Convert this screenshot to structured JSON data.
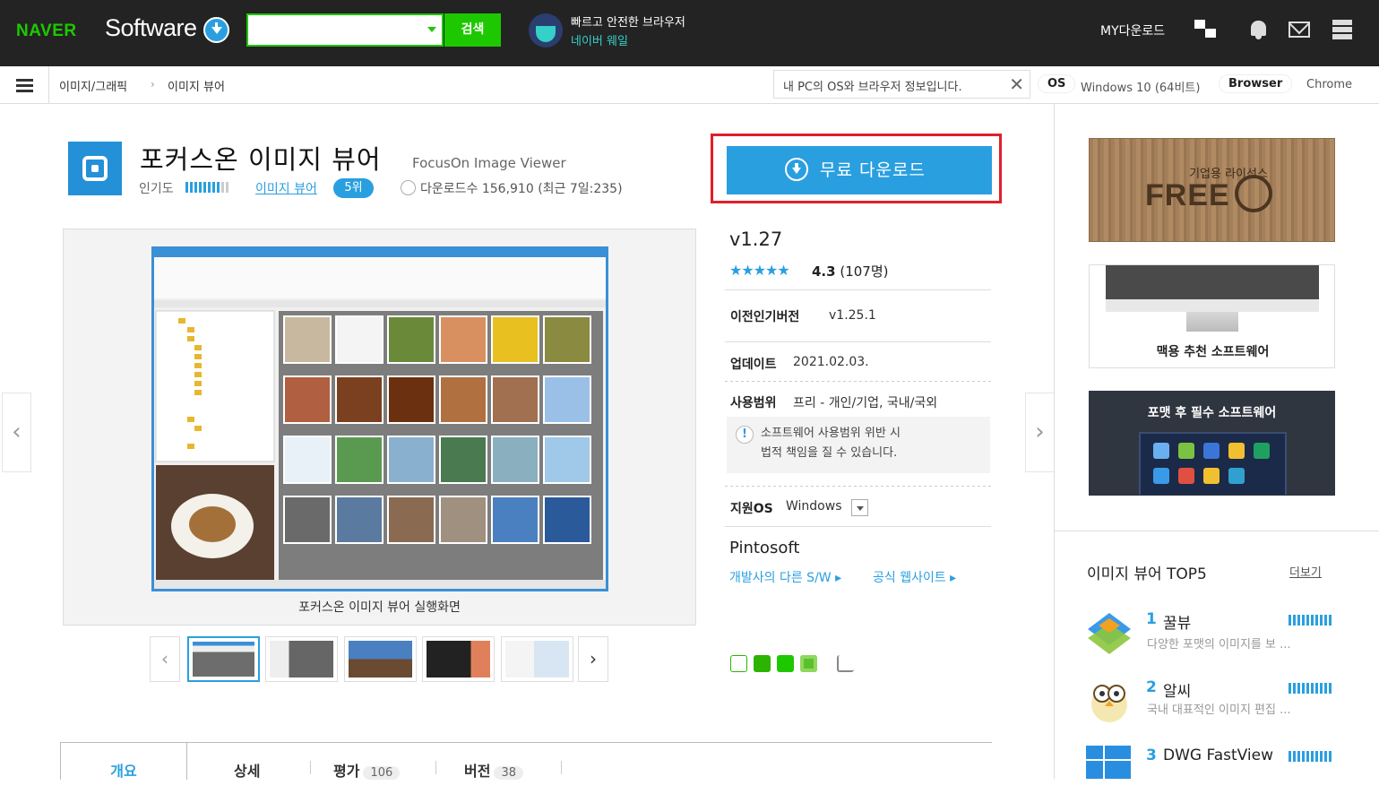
{
  "header": {
    "naver": "NAVER",
    "software": "Software",
    "search_button": "검색",
    "search_value": "",
    "whale_line1": "빠르고 안전한 브라우저",
    "whale_line2": "네이버 웨일",
    "my_download": "MY다운로드"
  },
  "subbar": {
    "breadcrumb": [
      "이미지/그래픽",
      "이미지 뷰어"
    ],
    "os_notice": "내 PC의 OS와 브라우저 정보입니다.",
    "os_label": "OS",
    "os_value": "Windows 10 (64비트)",
    "browser_label": "Browser",
    "browser_value": "Chrome"
  },
  "app": {
    "title": "포커스온 이미지 뷰어",
    "eng_title": "FocusOn Image Viewer",
    "popularity_label": "인기도",
    "popularity_level": 0.8,
    "category": "이미지 뷰어",
    "rank": "5위",
    "downloads": "다운로드수 156,910 (최근 7일:235)",
    "download_button": "무료 다운로드",
    "screenshot_caption": "포커스온 이미지 뷰어 실행화면",
    "version": "v1.27",
    "stars": "★★★★★",
    "rating_score": "4.3",
    "rating_count": "(107명)",
    "prev_version_label": "이전인기버전",
    "prev_version": "v1.25.1",
    "update_label": "업데이트",
    "update": "2021.02.03.",
    "scope_label": "사용범위",
    "scope": "프리 - 개인/기업, 국내/국외",
    "warning_line1": "소프트웨어 사용범위 위반 시",
    "warning_line2": "법적 책임을 질 수 있습니다.",
    "os_label": "지원OS",
    "os": "Windows",
    "developer": "Pintosoft",
    "dev_other": "개발사의 다른 S/W",
    "dev_site": "공식 웹사이트"
  },
  "sidebar": {
    "ad1_line1": "기업용 라이선스",
    "ad1_line2": "FREE",
    "ad2": "맥용 추천 소프트웨어",
    "ad3": "포맷 후 필수 소프트웨어",
    "top5_title": "이미지 뷰어 TOP5",
    "more": "더보기",
    "top5": [
      {
        "rank": "1",
        "name": "꿀뷰",
        "desc": "다양한 포맷의 이미지를 보 ..."
      },
      {
        "rank": "2",
        "name": "알씨",
        "desc": "국내 대표적인 이미지 편집 ..."
      },
      {
        "rank": "3",
        "name": "DWG FastView",
        "desc": ""
      }
    ]
  },
  "tabs": [
    {
      "label": "개요",
      "count": ""
    },
    {
      "label": "상세",
      "count": ""
    },
    {
      "label": "평가",
      "count": "106"
    },
    {
      "label": "버전",
      "count": "38"
    }
  ],
  "colors": {
    "accent": "#2a9fe0",
    "naver_green": "#1ec800",
    "highlight": "#e0202a"
  }
}
